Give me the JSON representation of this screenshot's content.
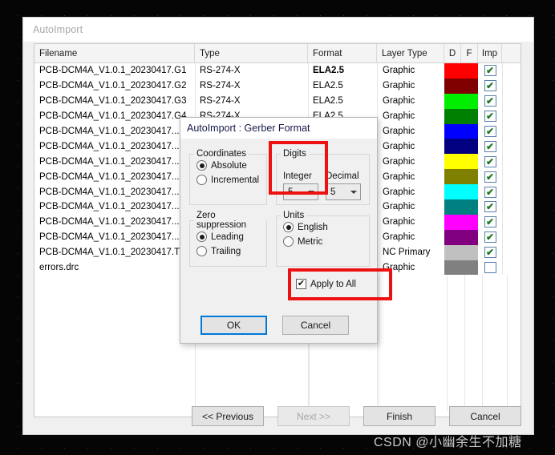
{
  "window": {
    "title": "AutoImport"
  },
  "list": {
    "columns": [
      "Filename",
      "Type",
      "Format",
      "Layer Type",
      "D",
      "F",
      "Imp"
    ],
    "rows": [
      {
        "filename": "PCB-DCM4A_V1.0.1_20230417.G1",
        "type": "RS-274-X",
        "format": "ELA2.5",
        "format_bold": true,
        "layer": "Graphic",
        "d": "#ff0000",
        "f": "#ff0000",
        "imp": true
      },
      {
        "filename": "PCB-DCM4A_V1.0.1_20230417.G2",
        "type": "RS-274-X",
        "format": "ELA2.5",
        "format_bold": false,
        "layer": "Graphic",
        "d": "#800000",
        "f": "#800000",
        "imp": true
      },
      {
        "filename": "PCB-DCM4A_V1.0.1_20230417.G3",
        "type": "RS-274-X",
        "format": "ELA2.5",
        "format_bold": false,
        "layer": "Graphic",
        "d": "#00ee00",
        "f": "#00ee00",
        "imp": true
      },
      {
        "filename": "PCB-DCM4A_V1.0.1_20230417.G4",
        "type": "RS-274-X",
        "format": "ELA2.5",
        "format_bold": false,
        "layer": "Graphic",
        "d": "#008000",
        "f": "#008000",
        "imp": true
      },
      {
        "filename": "PCB-DCM4A_V1.0.1_20230417...",
        "type": "",
        "format": "",
        "format_bold": false,
        "layer": "Graphic",
        "d": "#0000ff",
        "f": "#0000ff",
        "imp": true
      },
      {
        "filename": "PCB-DCM4A_V1.0.1_20230417...",
        "type": "",
        "format": "",
        "format_bold": false,
        "layer": "Graphic",
        "d": "#000080",
        "f": "#000080",
        "imp": true
      },
      {
        "filename": "PCB-DCM4A_V1.0.1_20230417...",
        "type": "",
        "format": "",
        "format_bold": false,
        "layer": "Graphic",
        "d": "#ffff00",
        "f": "#ffff00",
        "imp": true
      },
      {
        "filename": "PCB-DCM4A_V1.0.1_20230417...",
        "type": "",
        "format": "",
        "format_bold": false,
        "layer": "Graphic",
        "d": "#808000",
        "f": "#808000",
        "imp": true
      },
      {
        "filename": "PCB-DCM4A_V1.0.1_20230417...",
        "type": "",
        "format": "",
        "format_bold": false,
        "layer": "Graphic",
        "d": "#00ffff",
        "f": "#00ffff",
        "imp": true
      },
      {
        "filename": "PCB-DCM4A_V1.0.1_20230417...",
        "type": "",
        "format": "",
        "format_bold": false,
        "layer": "Graphic",
        "d": "#008080",
        "f": "#008080",
        "imp": true
      },
      {
        "filename": "PCB-DCM4A_V1.0.1_20230417...",
        "type": "",
        "format": "",
        "format_bold": false,
        "layer": "Graphic",
        "d": "#ff00ff",
        "f": "#ff00ff",
        "imp": true
      },
      {
        "filename": "PCB-DCM4A_V1.0.1_20230417...",
        "type": "",
        "format": "",
        "format_bold": false,
        "layer": "Graphic",
        "d": "#800080",
        "f": "#800080",
        "imp": true
      },
      {
        "filename": "PCB-DCM4A_V1.0.1_20230417.T",
        "type": "",
        "format": "",
        "format_bold": false,
        "layer": "NC Primary",
        "d": "#c0c0c0",
        "f": "#c0c0c0",
        "imp": true
      },
      {
        "filename": "errors.drc",
        "type": "",
        "format": "",
        "format_bold": false,
        "layer": "Graphic",
        "d": "#808080",
        "f": "#808080",
        "imp": false
      }
    ],
    "empty_row_count": 9
  },
  "footer": {
    "previous_label": "<< Previous",
    "next_label": "Next >>",
    "finish_label": "Finish",
    "cancel_label": "Cancel"
  },
  "dialog": {
    "title": "AutoImport : Gerber Format",
    "coordinates": {
      "legend": "Coordinates",
      "options": [
        {
          "label": "Absolute",
          "selected": true
        },
        {
          "label": "Incremental",
          "selected": false
        }
      ]
    },
    "zero_suppression": {
      "legend": "Zero suppression",
      "options": [
        {
          "label": "Leading",
          "selected": true
        },
        {
          "label": "Trailing",
          "selected": false
        }
      ]
    },
    "digits": {
      "legend": "Digits",
      "integer_label": "Integer",
      "integer_value": "5",
      "decimal_label": "Decimal",
      "decimal_value": "5"
    },
    "units": {
      "legend": "Units",
      "options": [
        {
          "label": "English",
          "selected": true
        },
        {
          "label": "Metric",
          "selected": false
        }
      ]
    },
    "apply_to_all": {
      "label": "Apply to All",
      "checked": true,
      "check_glyph": "✔"
    },
    "ok_label": "OK",
    "cancel_label": "Cancel"
  },
  "annotations": {
    "highlight_color": "#ee1111",
    "boxes": [
      "digits-group",
      "apply-to-all"
    ]
  },
  "watermark": {
    "text": "CSDN @小幽余生不加糖"
  }
}
